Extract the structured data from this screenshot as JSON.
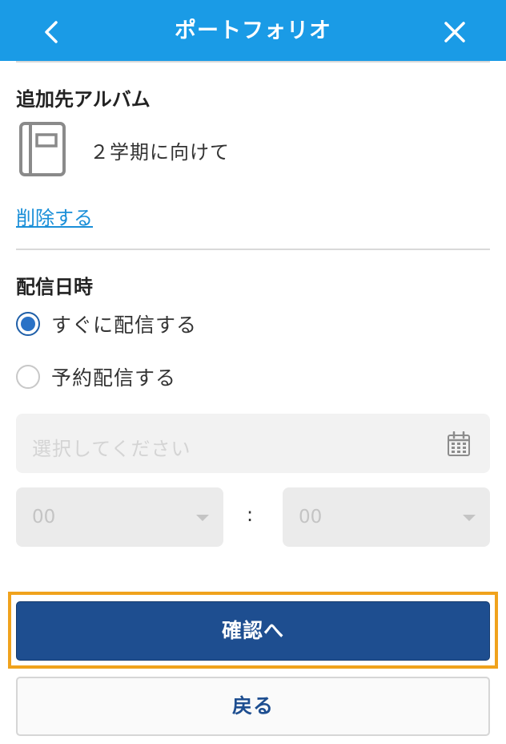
{
  "header": {
    "title": "ポートフォリオ",
    "back_icon": "chevron-left-icon",
    "close_icon": "close-icon",
    "background": "#1a9be6"
  },
  "album": {
    "section_title": "追加先アルバム",
    "icon": "album-book-icon",
    "name": "２学期に向けて",
    "delete_label": "削除する"
  },
  "delivery": {
    "section_title": "配信日時",
    "options": [
      {
        "label": "すぐに配信する",
        "selected": true
      },
      {
        "label": "予約配信する",
        "selected": false
      }
    ],
    "date_placeholder": "選択してください",
    "calendar_icon": "calendar-icon",
    "hour_value": "00",
    "minute_value": "00",
    "separator": ":"
  },
  "actions": {
    "confirm_label": "確認へ",
    "back_label": "戻る",
    "confirm_color": "#1e4e90",
    "highlight_color": "#f0a21c"
  }
}
